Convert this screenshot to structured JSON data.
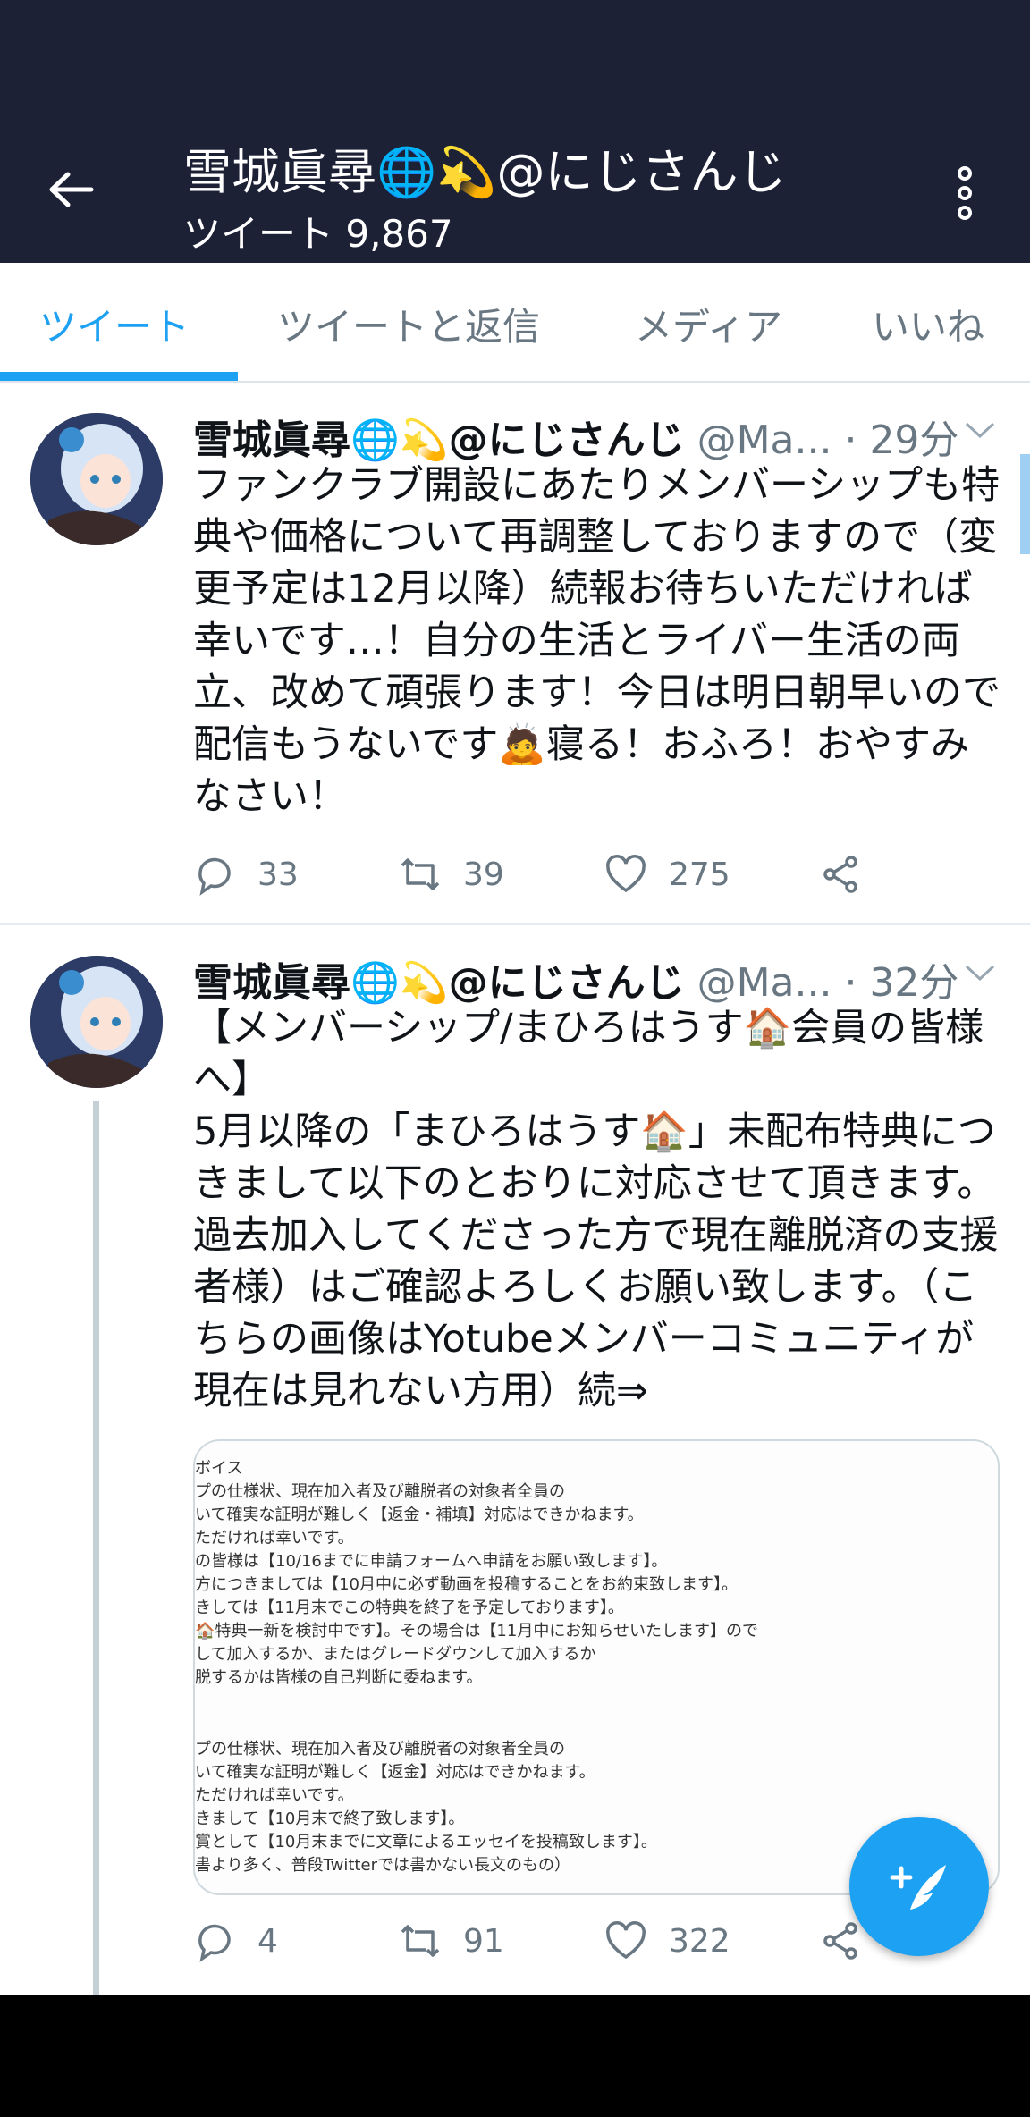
{
  "header": {
    "title": "雪城眞尋🌐💫@にじさんじ",
    "tweet_count": "ツイート 9,867"
  },
  "tabs": [
    {
      "label": "ツイート",
      "active": true
    },
    {
      "label": "ツイートと返信",
      "active": false
    },
    {
      "label": "メディア",
      "active": false
    },
    {
      "label": "いいね",
      "active": false
    }
  ],
  "tweets": [
    {
      "name": "雪城眞尋🌐💫@にじさんじ",
      "handle": "@Ma...",
      "time": "· 29分",
      "text": "ファンクラブ開設にあたりメンバーシップも特典や価格について再調整しておりますので（変更予定は12月以降）続報お待ちいただければ幸いです…！自分の生活とライバー生活の両立、改めて頑張ります！今日は明日朝早いので配信もうないです🙇寝る！おふろ！おやすみなさい！",
      "replies": "33",
      "retweets": "39",
      "likes": "275"
    },
    {
      "name": "雪城眞尋🌐💫@にじさんじ",
      "handle": "@Ma...",
      "time": "· 32分",
      "text": "【メンバーシップ/まひろはうす🏠会員の皆様へ】\n5月以降の「まひろはうす🏠」未配布特典につきまして以下のとおりに対応させて頂きます。過去加入してくださった方で現在離脱済の支援者様）はご確認よろしくお願い致します。（こちらの画像はYotubeメンバーコミュニティが現在は見れない方用）続⇒",
      "replies": "4",
      "retweets": "91",
      "likes": "322",
      "image_lines": [
        "ボイス",
        "プの仕様状、現在加入者及び離脱者の対象者全員の",
        "いて確実な証明が難しく【返金・補填】対応はできかねます。",
        "ただければ幸いです。",
        "の皆様は【10/16までに申請フォームへ申請をお願い致します】。",
        "方につきましては【10月中に必ず動画を投稿することをお約束致します】。",
        "きしては【11月末でこの特典を終了を予定しております】。",
        "🏠特典一新を検討中です】。その場合は【11月中にお知らせいたします】ので",
        "して加入するか、またはグレードダウンして加入するか",
        "脱するかは皆様の自己判断に委ねます。",
        "プの仕様状、現在加入者及び離脱者の対象者全員の",
        "いて確実な証明が難しく【返金】対応はできかねます。",
        "ただければ幸いです。",
        "きまして【10月末で終了致します】。",
        "賞として【10月末までに文章によるエッセイを投稿致します】。",
        "書より多く、普段Twitterでは書かない長文のもの）"
      ]
    }
  ]
}
